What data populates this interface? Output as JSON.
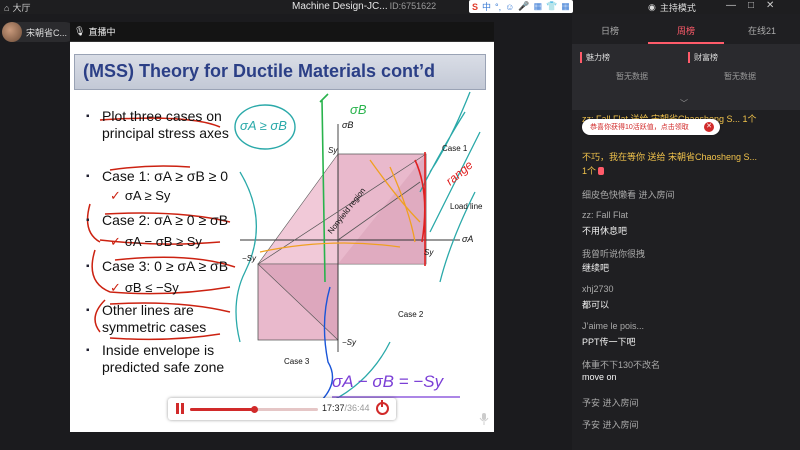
{
  "titlebar": {
    "hall_label": "大厅",
    "window_title": "Machine Design-JC...",
    "room_id": "ID:6751622",
    "sogou_items": [
      "S",
      "中",
      "°,",
      "☺",
      "🎤",
      "▦",
      "👕",
      "▦"
    ],
    "mode_label": "主持模式",
    "window_buttons": [
      "—",
      "□",
      "✕"
    ]
  },
  "host": {
    "name": "宋朝省C..."
  },
  "live_badge": "直播中",
  "slide": {
    "title": "(MSS) Theory for Ductile Materials cont’d",
    "bullets": [
      "Plot three cases on principal stress axes",
      "Case 1: σA ≥ σB ≥ 0",
      "Case 2: σA ≥ 0 ≥ σB",
      "Case 3: 0 ≥ σA ≥ σB",
      "Other lines are symmetric cases",
      "Inside envelope is predicted safe zone"
    ],
    "checks": [
      "σA ≥ Sy",
      "σA − σB ≥ Sy",
      "σB ≤ −Sy"
    ],
    "figure_labels": {
      "sb": "σB",
      "sy_top": "Sy",
      "case1": "Case 1",
      "load_line": "Load line",
      "sa": "σA",
      "sy_right": "Sy",
      "neg_sy_left": "−Sy",
      "neg_sy_bottom": "−Sy",
      "nonyield": "Nonyield region",
      "case2": "Case 2",
      "case3": "Case 3"
    },
    "ink": {
      "box_formula": "σA ≥ σB",
      "sigma_b": "σB",
      "range": "range",
      "bottom_formula": "σA − σB = −Sy"
    }
  },
  "player": {
    "current": "17:37",
    "total": "/36:44",
    "progress": 0.5
  },
  "panel": {
    "tabs": [
      "日榜",
      "周榜",
      "在线21"
    ],
    "active_tab": 1,
    "rank_left": {
      "title": "魅力榜",
      "empty": "暂无数据"
    },
    "rank_right": {
      "title": "财富榜",
      "empty": "暂无数据"
    },
    "toast": "恭喜你获得10活跃值，点击领取",
    "messages": [
      {
        "text": "zz: Fall Flat 送给 宋朝省Chaosheng S... 1个",
        "style": "gold"
      },
      {
        "text": "不巧，我在等你 送给 宋朝省Chaosheng S...",
        "style": "gold"
      },
      {
        "text": "1个",
        "style": "gold"
      },
      {
        "text": "细皮色快懒看 进入房间",
        "style": "gray"
      },
      {
        "text": "zz: Fall Flat",
        "style": "gray"
      },
      {
        "text": "不用休息吧",
        "style": "white"
      },
      {
        "text": "我曾听说你很拽",
        "style": "gray"
      },
      {
        "text": "继续吧",
        "style": "white"
      },
      {
        "text": "xhj2730",
        "style": "gray"
      },
      {
        "text": "都可以",
        "style": "white"
      },
      {
        "text": "J’aime le pois...",
        "style": "gray"
      },
      {
        "text": "PPT传一下吧",
        "style": "white"
      },
      {
        "text": "体重不下130不改名",
        "style": "gray"
      },
      {
        "text": "move on",
        "style": "white"
      },
      {
        "text": "予安 进入房间",
        "style": "gray"
      },
      {
        "text": "予安 进入房间",
        "style": "gray"
      }
    ]
  },
  "colors": {
    "accent": "#ff5b6a",
    "slide_title": "#2b3f86",
    "ink_red": "#c21",
    "ink_blue": "#1a55d8",
    "ink_teal": "#2aa9a9",
    "ink_green": "#29b34c"
  }
}
